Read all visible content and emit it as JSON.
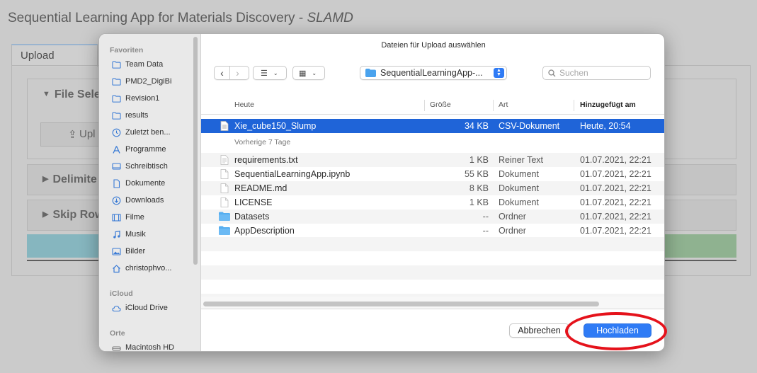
{
  "app": {
    "title_main": "Sequential Learning App for Materials Discovery - ",
    "title_italic": "SLAMD",
    "tab": "Upload",
    "section_file_select": "File Sele",
    "upload_button": "Upl",
    "section_delimiter": "Delimite",
    "section_skip_rows": "Skip Row"
  },
  "dialog": {
    "title": "Dateien für Upload auswählen",
    "path": "SequentialLearningApp-...",
    "search_placeholder": "Suchen",
    "sidebar": {
      "favorites_label": "Favoriten",
      "favorites": [
        {
          "label": "Team Data",
          "icon": "folder-icon"
        },
        {
          "label": "PMD2_DigiBi",
          "icon": "folder-icon"
        },
        {
          "label": "Revision1",
          "icon": "folder-icon"
        },
        {
          "label": "results",
          "icon": "folder-icon"
        },
        {
          "label": "Zuletzt ben...",
          "icon": "clock-icon"
        },
        {
          "label": "Programme",
          "icon": "apps-icon"
        },
        {
          "label": "Schreibtisch",
          "icon": "desktop-icon"
        },
        {
          "label": "Dokumente",
          "icon": "document-icon"
        },
        {
          "label": "Downloads",
          "icon": "download-icon"
        },
        {
          "label": "Filme",
          "icon": "film-icon"
        },
        {
          "label": "Musik",
          "icon": "music-icon"
        },
        {
          "label": "Bilder",
          "icon": "photo-icon"
        },
        {
          "label": "christophvo...",
          "icon": "home-icon"
        }
      ],
      "icloud_label": "iCloud",
      "icloud": [
        {
          "label": "iCloud Drive",
          "icon": "cloud-icon"
        }
      ],
      "places_label": "Orte",
      "places": [
        {
          "label": "Macintosh HD",
          "icon": "disk-icon"
        }
      ]
    },
    "columns": {
      "name": "Heute",
      "size": "Größe",
      "kind": "Art",
      "date": "Hinzugefügt am"
    },
    "group_today": "Heute",
    "group_previous": "Vorherige 7 Tage",
    "files_today": [
      {
        "name": "Xie_cube150_Slump",
        "size": "34 KB",
        "kind": "CSV-Dokument",
        "date": "Heute, 20:54",
        "icon": "csv-file-icon",
        "selected": true
      }
    ],
    "files_previous": [
      {
        "name": "requirements.txt",
        "size": "1 KB",
        "kind": "Reiner Text",
        "date": "01.07.2021, 22:21",
        "icon": "text-file-icon"
      },
      {
        "name": "SequentialLearningApp.ipynb",
        "size": "55 KB",
        "kind": "Dokument",
        "date": "01.07.2021, 22:21",
        "icon": "file-icon"
      },
      {
        "name": "README.md",
        "size": "8 KB",
        "kind": "Dokument",
        "date": "01.07.2021, 22:21",
        "icon": "file-icon"
      },
      {
        "name": "LICENSE",
        "size": "1 KB",
        "kind": "Dokument",
        "date": "01.07.2021, 22:21",
        "icon": "file-icon"
      },
      {
        "name": "Datasets",
        "size": "--",
        "kind": "Ordner",
        "date": "01.07.2021, 22:21",
        "icon": "folder-icon"
      },
      {
        "name": "AppDescription",
        "size": "--",
        "kind": "Ordner",
        "date": "01.07.2021, 22:21",
        "icon": "folder-icon"
      }
    ],
    "cancel_button": "Abbrechen",
    "upload_button": "Hochladen"
  },
  "colors": {
    "accent": "#2f7bf5",
    "selection": "#1f64d8",
    "annotation": "#e5121b"
  }
}
